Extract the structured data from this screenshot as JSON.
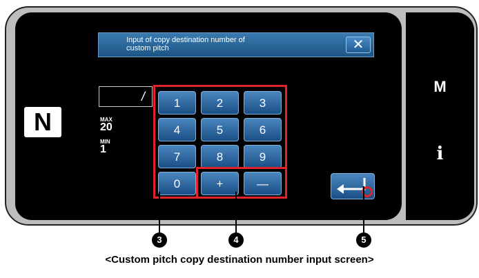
{
  "dialog": {
    "title_line1": "Input of copy destination number of",
    "title_line2": "custom pitch",
    "close_label": "✕"
  },
  "input": {
    "value": "/"
  },
  "limits": {
    "max_label": "MAX",
    "max_value": "20",
    "min_label": "MIN",
    "min_value": "1"
  },
  "nfc_label": "N",
  "keypad": {
    "k1": "1",
    "k2": "2",
    "k3": "3",
    "k4": "4",
    "k5": "5",
    "k6": "6",
    "k7": "7",
    "k8": "8",
    "k9": "9",
    "k0": "0",
    "plus": "+",
    "minus": "—"
  },
  "side": {
    "m_label": "M",
    "info_label": "i"
  },
  "callouts": {
    "c3": "3",
    "c4": "4",
    "c5": "5"
  },
  "caption": "<Custom pitch copy destination number input screen>",
  "colors": {
    "key_blue": "#2b67a3",
    "highlight_red": "#e0242a"
  }
}
